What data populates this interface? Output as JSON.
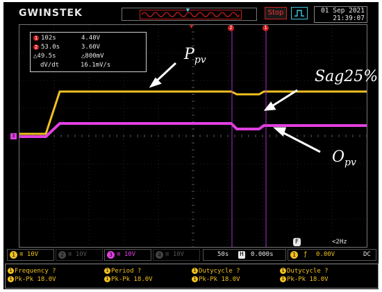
{
  "header": {
    "brand": "GWINSTEK",
    "status_button": "Stop",
    "date": "01 Sep 2021",
    "time": "21:39:07"
  },
  "measurements": {
    "rows": [
      {
        "a": "102s",
        "b": "4.40V"
      },
      {
        "a": "53.0s",
        "b": "3.60V"
      },
      {
        "a": "△49.5s",
        "b": "△800mV"
      },
      {
        "a": "dV/dt",
        "b": "16.1mV/s"
      }
    ],
    "cursor_marks": [
      "1",
      "2"
    ]
  },
  "annotations": {
    "ppv_main": "P",
    "ppv_sub": "pv",
    "sag": "Sag25%",
    "opv_main": "O",
    "opv_sub": "pv"
  },
  "markers": {
    "trigger_pos_top": "▼",
    "cursor2_top": "2",
    "cursor1_top": "1",
    "ch3_left": "3"
  },
  "channels": [
    {
      "num": "1",
      "scale": "10V",
      "color": "#f0c020",
      "active": true
    },
    {
      "num": "2",
      "scale": "10V",
      "color": "#555555",
      "active": false
    },
    {
      "num": "3",
      "scale": "10V",
      "color": "#e040e0",
      "active": true
    },
    {
      "num": "4",
      "scale": "10V",
      "color": "#555555",
      "active": false
    }
  ],
  "timebase": {
    "scale": "50s",
    "h_label": "H",
    "position": "0.000s"
  },
  "trigger": {
    "channel": "1",
    "slope": "ƒ",
    "level": "0.00V",
    "coupling": "DC"
  },
  "freq_display": {
    "f_label": "F",
    "value": "<2Hz"
  },
  "footer": {
    "cells": [
      {
        "num": "1",
        "line1": "Frequency ?",
        "line2": "Pk-Pk 18.0V"
      },
      {
        "num": "1",
        "line1": "Period ?",
        "line2": "Pk-Pk 18.0V"
      },
      {
        "num": "1",
        "line1": "Dutycycle ?",
        "line2": "Pk-Pk 18.0V"
      },
      {
        "num": "1",
        "line1": "Dutycycle ?",
        "line2": "Pk-Pk 18.0V"
      }
    ]
  },
  "colors": {
    "ch1_yellow": "#f0c020",
    "ch3_magenta": "#e040e0",
    "cursor_purple": "#b030d0",
    "stop_red": "#d02020",
    "accent_cyan": "#40c8e0"
  }
}
